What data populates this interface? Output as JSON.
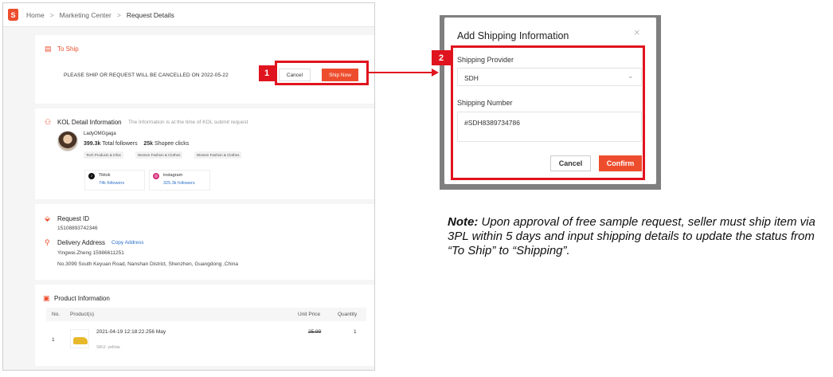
{
  "breadcrumb": {
    "logo": "S",
    "home": "Home",
    "sep": ">",
    "marketing": "Marketing Center",
    "current": "Request Details"
  },
  "ship": {
    "icon": "clipboard-icon",
    "title": "To Ship",
    "warning": "PLEASE SHIP OR REQUEST WILL BE CANCELLED ON 2022-05-22",
    "cancel": "Cancel",
    "ship_now": "Ship Now",
    "badge": "1"
  },
  "kol": {
    "title": "KOL Detail Information",
    "note": "The Information is at the time of KOL submit request",
    "name": "LadyOMGgaga",
    "followers_value": "399.3k",
    "followers_label": "Total followers",
    "clicks_value": "25k",
    "clicks_label": "Shopee clicks",
    "tags": [
      "Tech Products & Infos",
      "Women Fashion & Clothes",
      "Women Fashion & Clothes"
    ],
    "socials": [
      {
        "name": "Tiktok",
        "followers": "74k followers",
        "icon": "tiktok-icon"
      },
      {
        "name": "instagram",
        "followers": "325.3k followers",
        "icon": "instagram-icon"
      }
    ]
  },
  "request": {
    "id_title": "Request ID",
    "id_value": "15108893742346",
    "address_title": "Delivery Address",
    "copy_address": "Copy Address",
    "contact": "Yingwei.Zheng   15986611251",
    "address": "No.3099 South Keyuan Road, Nanshan District, Shenzhen, Guangdong ,China"
  },
  "product": {
    "title": "Product Information",
    "columns": {
      "no": "No.",
      "product": "Product(s)",
      "unit_price": "Unit Price",
      "quantity": "Quantity"
    },
    "rows": [
      {
        "no": "1",
        "name": "2021-04-19 12:18:22.256 May",
        "sku": "SKU: yellow",
        "price": "25.99",
        "quantity": "1"
      }
    ]
  },
  "dialog": {
    "title": "Add Shipping Information",
    "close": "×",
    "provider_label": "Shipping Provider",
    "provider_value": "SDH",
    "chevron": "⌄",
    "number_label": "Shipping Number",
    "number_value": "#SDH8389734786",
    "cancel": "Cancel",
    "confirm": "Confirm",
    "badge": "2"
  },
  "note": {
    "lead": "Note:",
    "text": " Upon approval of free sample request, seller must ship item via 3PL within 5 days and input shipping details to update the status from “To Ship” to “Shipping”."
  },
  "colors": {
    "brand": "#ee4d2d",
    "highlight": "#e0141e",
    "link": "#2a6fc9"
  }
}
